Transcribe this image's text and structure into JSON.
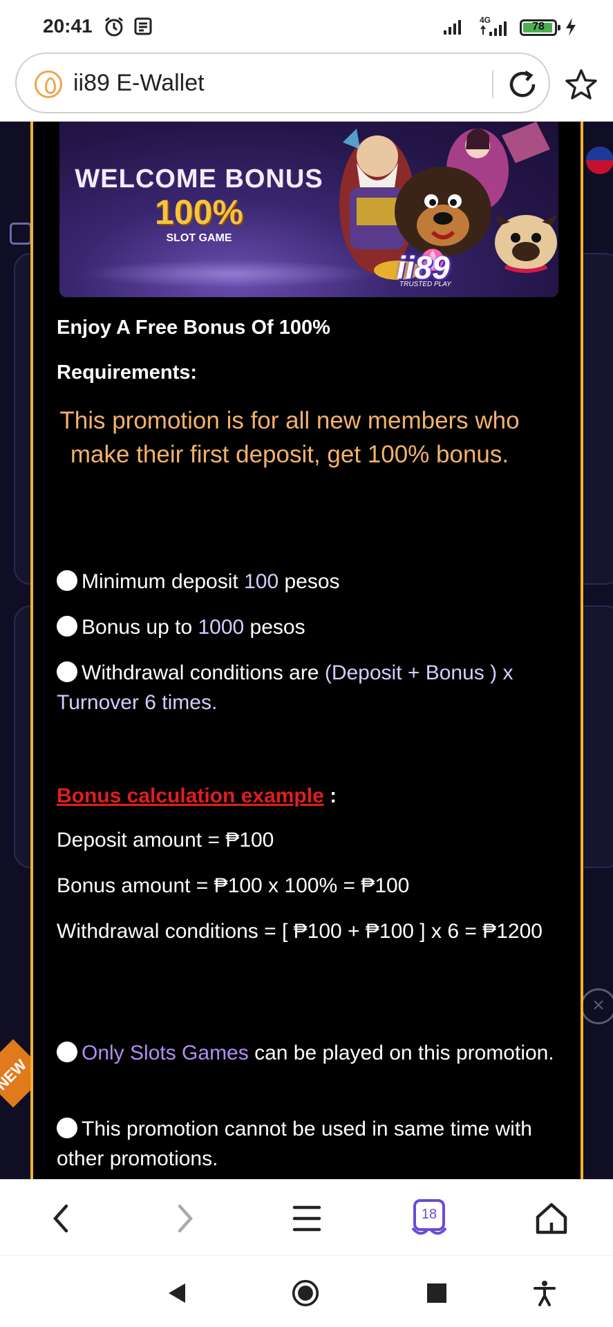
{
  "status_bar": {
    "time": "20:41",
    "network": "4G",
    "battery": "78"
  },
  "browser": {
    "url_title": "ii89 E-Wallet",
    "tab_count": "18"
  },
  "banner": {
    "title": "WELCOME BONUS",
    "percent": "100%",
    "subtitle": "SLOT GAME",
    "logo": "ii89",
    "logo_tagline": "TRUSTED PLAY"
  },
  "content": {
    "heading": "Enjoy A Free Bonus Of 100%",
    "requirements_label": "Requirements:",
    "promo_text": "This promotion is for all new members who make their first deposit, get 100% bonus.",
    "bullets": [
      {
        "pre": "Minimum deposit ",
        "value": "100",
        "post": " pesos"
      },
      {
        "pre": "Bonus up to ",
        "value": "1000",
        "post": " pesos"
      },
      {
        "pre": "Withdrawal conditions are ",
        "value": "(Deposit + Bonus ) x Turnover 6 times.",
        "post": ""
      }
    ],
    "calc_title": "Bonus calculation example",
    "calc_colon": " :",
    "calc_lines": [
      "Deposit amount = ₱100",
      "Bonus amount = ₱100 x 100% = ₱100",
      "Withdrawal conditions = [ ₱100 + ₱100 ] x 6 = ₱1200"
    ],
    "slots_highlight": "Only Slots Games",
    "slots_rest": " can be played on this promotion.",
    "last_rule": "This promotion cannot be used in same time with other promotions."
  },
  "background": {
    "new_tag": "NEW"
  },
  "colors": {
    "accent_gold": "#f0b429",
    "promo_orange": "#f5b26b",
    "link_red": "#e01e1e",
    "highlight_purple": "#b48cf5",
    "value_lavender": "#d8ccff"
  },
  "icons": {
    "status": [
      "alarm-icon",
      "notification-icon",
      "signal-icon",
      "battery-icon",
      "charging-icon"
    ],
    "browser": [
      "site-icon",
      "reload-icon",
      "bookmark-star-icon"
    ],
    "toolbar": [
      "back-icon",
      "forward-icon",
      "menu-icon",
      "tabs-icon",
      "home-icon"
    ],
    "nav": [
      "nav-back-icon",
      "nav-home-icon",
      "nav-recents-icon",
      "accessibility-icon"
    ]
  }
}
